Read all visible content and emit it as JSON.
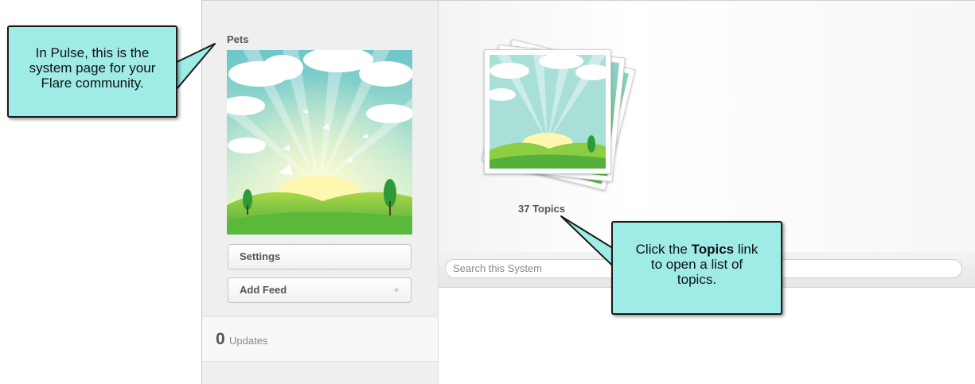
{
  "sidebar": {
    "system_title": "Pets",
    "settings_label": "Settings",
    "add_feed_label": "Add Feed",
    "add_feed_icon": "+",
    "updates_count": "0",
    "updates_label": "Updates"
  },
  "main": {
    "topics_link": "37 Topics",
    "search_placeholder": "Search this System"
  },
  "callouts": {
    "pulse_lines": [
      "In Pulse, this is the",
      "system page for your",
      "Flare community."
    ],
    "topics_pre": "Click the ",
    "topics_bold": "Topics",
    "topics_post": " link",
    "topics_lines": [
      "to open a list of",
      "topics."
    ]
  },
  "colors": {
    "callout_fill": "#9fece7",
    "sidebar_bg": "#efefef"
  }
}
